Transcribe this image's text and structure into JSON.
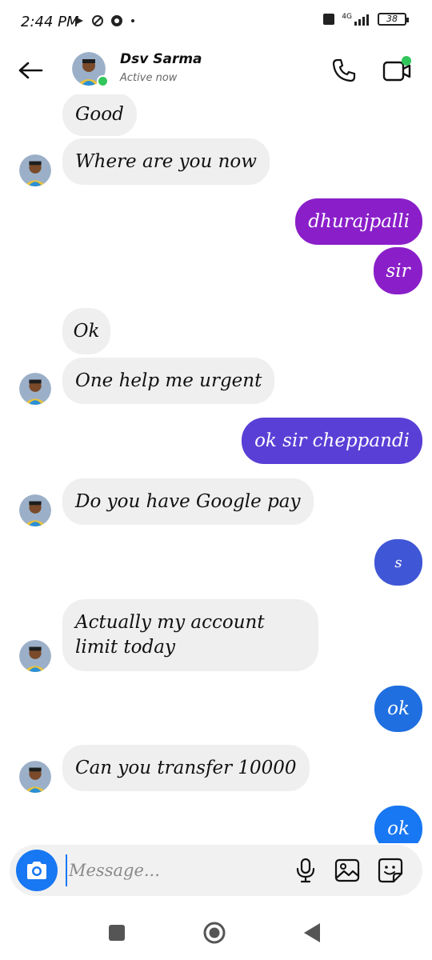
{
  "status_bar": {
    "time": "2:44 PM",
    "battery": "38",
    "network": "4G"
  },
  "header": {
    "name": "Dsv Sarma",
    "status": "Active now"
  },
  "messages": [
    {
      "dir": "in",
      "text": "Good"
    },
    {
      "dir": "in",
      "text": "Where are you now"
    },
    {
      "dir": "out",
      "text": "dhurajpalli",
      "color": "#8a1fc9"
    },
    {
      "dir": "out",
      "text": "sir",
      "color": "#8a1fc9"
    },
    {
      "dir": "in",
      "text": "Ok"
    },
    {
      "dir": "in",
      "text": "One help me urgent"
    },
    {
      "dir": "out",
      "text": "ok sir cheppandi",
      "color": "#5a3fd6"
    },
    {
      "dir": "in",
      "text": "Do you have Google pay"
    },
    {
      "dir": "out",
      "text": "s",
      "color": "#3f56d6"
    },
    {
      "dir": "in",
      "text": "Actually my account limit today"
    },
    {
      "dir": "out",
      "text": "ok",
      "color": "#1f6fe0"
    },
    {
      "dir": "in",
      "text": "Can you transfer 10000"
    },
    {
      "dir": "out",
      "text": "ok",
      "color": "#1877f2"
    }
  ],
  "composer": {
    "placeholder": "Message..."
  },
  "colors": {
    "accent": "#1877f2",
    "online": "#31c65b",
    "incoming_bubble": "#efefef"
  },
  "icons": [
    "back-arrow-icon",
    "phone-icon",
    "video-camera-icon",
    "camera-icon",
    "microphone-icon",
    "gallery-icon",
    "sticker-icon"
  ]
}
